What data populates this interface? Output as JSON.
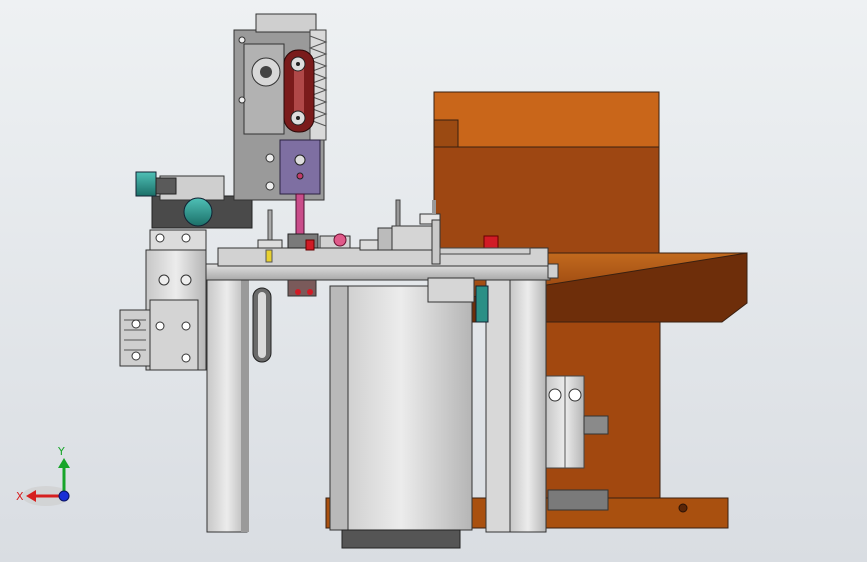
{
  "viewport": {
    "background_top": "#eef1f3",
    "background_bottom": "#d9dde2"
  },
  "triad": {
    "x_label": "X",
    "y_label": "Y",
    "x_color": "#d61f1f",
    "y_color": "#17a52a",
    "z_color": "#1a2fd6"
  },
  "palette": {
    "orange": "#c56516",
    "orange_light": "#d97a22",
    "brown": "#8b3d10",
    "grey_light": "#d8d8d8",
    "grey_mid": "#b8b8b8",
    "grey_dark": "#6e6e6e",
    "teal": "#2a8f86",
    "maroon": "#7a1b1b",
    "purple": "#7d6ea0",
    "red": "#d11b26"
  }
}
